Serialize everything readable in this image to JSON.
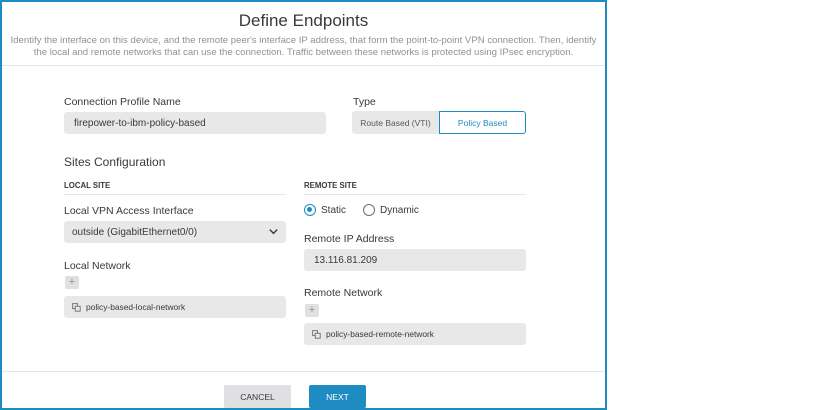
{
  "dialog": {
    "title": "Define Endpoints",
    "description": "Identify the interface on this device, and the remote peer's interface IP address, that form the point-to-point VPN connection. Then, identify the local and remote networks that can use the connection. Traffic between these networks is protected using IPsec encryption."
  },
  "connection_profile": {
    "label": "Connection Profile Name",
    "value": "firepower-to-ibm-policy-based"
  },
  "type": {
    "label": "Type",
    "options": [
      "Route Based (VTI)",
      "Policy Based"
    ],
    "selected": "Policy Based"
  },
  "sites": {
    "title": "Sites Configuration",
    "local": {
      "heading": "LOCAL SITE",
      "interface_label": "Local VPN Access Interface",
      "interface_value": "outside (GigabitEthernet0/0)",
      "network_label": "Local Network",
      "add_symbol": "+",
      "network_item": "policy-based-local-network"
    },
    "remote": {
      "heading": "REMOTE SITE",
      "radio_options": [
        "Static",
        "Dynamic"
      ],
      "radio_selected": "Static",
      "ip_label": "Remote IP Address",
      "ip_value": "13.116.81.209",
      "network_label": "Remote Network",
      "add_symbol": "+",
      "network_item": "policy-based-remote-network"
    }
  },
  "footer": {
    "cancel_label": "CANCEL",
    "next_label": "NEXT"
  },
  "colors": {
    "accent": "#1e8bc3",
    "field_bg": "#e8e8e9",
    "text": "#39393b",
    "muted_text": "#8e9196"
  },
  "icons": {
    "chevron": "chevron-down-icon",
    "network": "network-object-icon",
    "plus": "plus-icon"
  }
}
